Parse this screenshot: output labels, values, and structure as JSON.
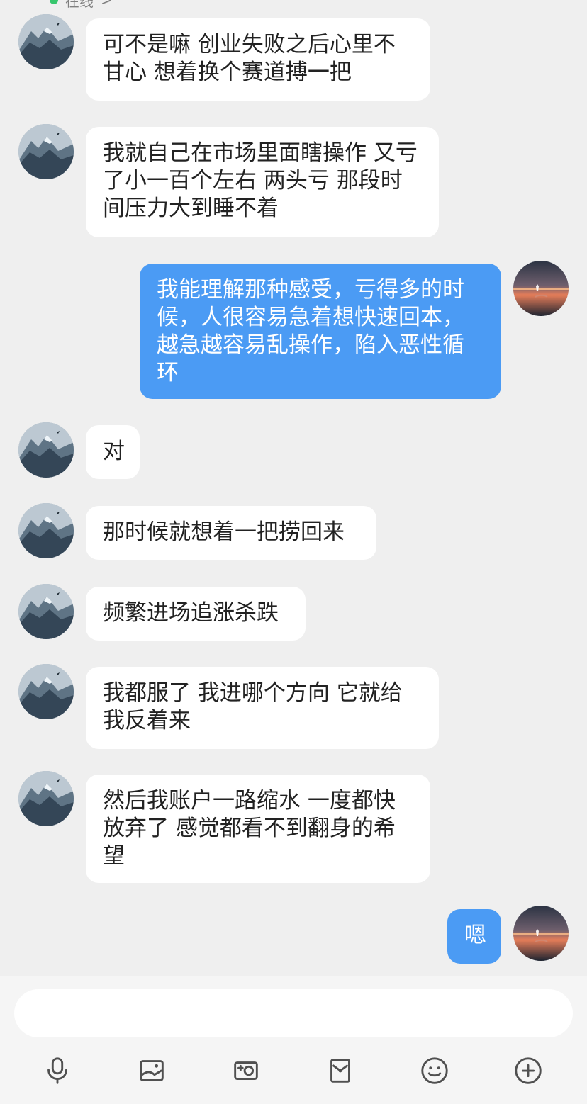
{
  "header": {
    "status": "在线",
    "status_chevron": ">"
  },
  "conversation": {
    "messages": [
      {
        "side": "left",
        "text": "可不是嘛 创业失败之后心里不甘心 想着换个赛道搏一把"
      },
      {
        "side": "left",
        "text": "我就自己在市场里面瞎操作 又亏了小一百个左右 两头亏 那段时间压力大到睡不着"
      },
      {
        "side": "right",
        "text": "我能理解那种感受，亏得多的时候，人很容易急着想快速回本，越急越容易乱操作，陷入恶性循环"
      },
      {
        "side": "left",
        "text": "对"
      },
      {
        "side": "left",
        "text": "那时候就想着一把捞回来"
      },
      {
        "side": "left",
        "text": "频繁进场追涨杀跌"
      },
      {
        "side": "left",
        "text": "我都服了 我进哪个方向 它就给我反着来"
      },
      {
        "side": "left",
        "text": "然后我账户一路缩水 一度都快放弃了 感觉都看不到翻身的希望"
      },
      {
        "side": "right",
        "text": "嗯"
      }
    ]
  },
  "input": {
    "placeholder": ""
  },
  "toolbar": {
    "icons": [
      "microphone-icon",
      "image-icon",
      "camera-icon",
      "red-packet-icon",
      "emoji-icon",
      "plus-icon"
    ]
  }
}
